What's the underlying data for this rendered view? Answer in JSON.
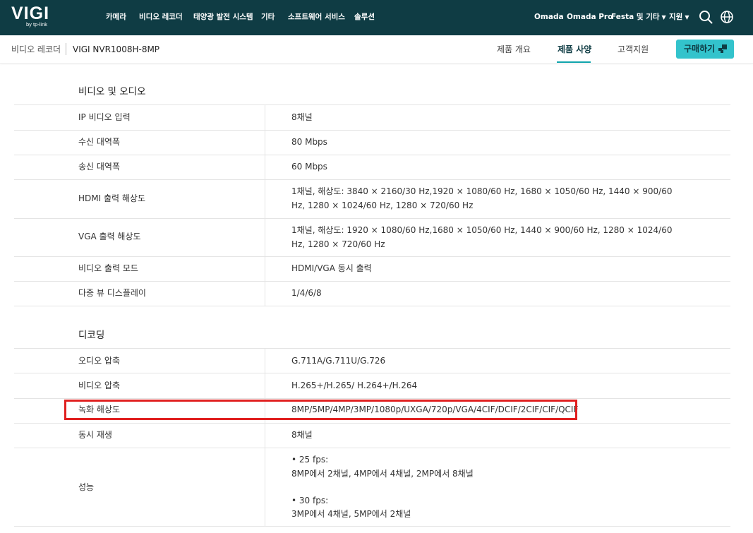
{
  "nav": {
    "logo_text": "VIGI",
    "logo_sub": "by tp-link",
    "menu": [
      "카메라",
      "비디오 레코더",
      "태양광 발전 시스템",
      "기타",
      "소프트웨어 서비스",
      "솔루션"
    ],
    "right_links": [
      "Omada",
      "Omada Pro",
      "Festa 및 기타",
      "지원"
    ],
    "search_icon": "search-icon",
    "globe_icon": "globe-icon"
  },
  "subbar": {
    "breadcrumb_parent": "비디오 레코더",
    "breadcrumb_current": "VIGI NVR1008H-8MP",
    "tabs": [
      "제품 개요",
      "제품 사양",
      "고객지원"
    ],
    "active_tab": "제품 사양",
    "buy_label": "구매하기",
    "accent_color": "#33c3cc"
  },
  "spec": {
    "sections": [
      {
        "title": "비디오 및 오디오",
        "rows": [
          {
            "label": "IP 비디오 입력",
            "value": "8채널"
          },
          {
            "label": "수신 대역폭",
            "value": "80 Mbps"
          },
          {
            "label": "송신 대역폭",
            "value": "60 Mbps"
          },
          {
            "label": "HDMI 출력 해상도",
            "value": "1채널, 해상도: 3840 × 2160/30 Hz,1920 × 1080/60 Hz, 1680 × 1050/60 Hz, 1440 × 900/60 Hz, 1280 × 1024/60 Hz, 1280 × 720/60 Hz"
          },
          {
            "label": "VGA 출력 해상도",
            "value": "1채널, 해상도: 1920 × 1080/60 Hz,1680 × 1050/60 Hz, 1440 × 900/60 Hz, 1280 × 1024/60 Hz, 1280 × 720/60 Hz"
          },
          {
            "label": "비디오 출력 모드",
            "value": "HDMI/VGA 동시 출력"
          },
          {
            "label": "다중 뷰 디스플레이",
            "value": "1/4/6/8"
          }
        ]
      },
      {
        "title": "디코딩",
        "rows": [
          {
            "label": "오디오 압축",
            "value": "G.711A/G.711U/G.726"
          },
          {
            "label": "비디오 압축",
            "value": "H.265+/H.265/ H.264+/H.264"
          },
          {
            "label": "녹화 해상도",
            "value": "8MP/5MP/4MP/3MP/1080p/UXGA/720p/VGA/4CIF/DCIF/2CIF/CIF/QCIF"
          },
          {
            "label": "동시 재생",
            "value": "8채널"
          },
          {
            "label": "성능",
            "value_lines": [
              "• 25 fps:",
              "8MP에서 2채널, 4MP에서 4채널, 2MP에서 8채널",
              "",
              "• 30 fps:",
              "3MP에서 4채널, 5MP에서 2채널"
            ]
          }
        ]
      }
    ],
    "highlight_color": "#e02020"
  }
}
